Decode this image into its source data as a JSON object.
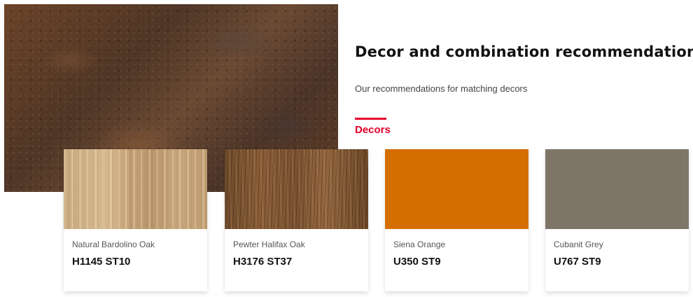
{
  "section": {
    "title": "Decor and combination recommendations",
    "subtitle": "Our recommendations for matching decors",
    "active_tab": "Decors"
  },
  "cards": [
    {
      "name": "Natural Bardolino Oak",
      "code": "H1145 ST10"
    },
    {
      "name": "Pewter Halifax Oak",
      "code": "H3176 ST37"
    },
    {
      "name": "Siena Orange",
      "code": "U350 ST9",
      "color": "#d46e00"
    },
    {
      "name": "Cubanit Grey",
      "code": "U767 ST9",
      "color": "#7e7568"
    }
  ],
  "colors": {
    "accent": "#e4002b"
  }
}
